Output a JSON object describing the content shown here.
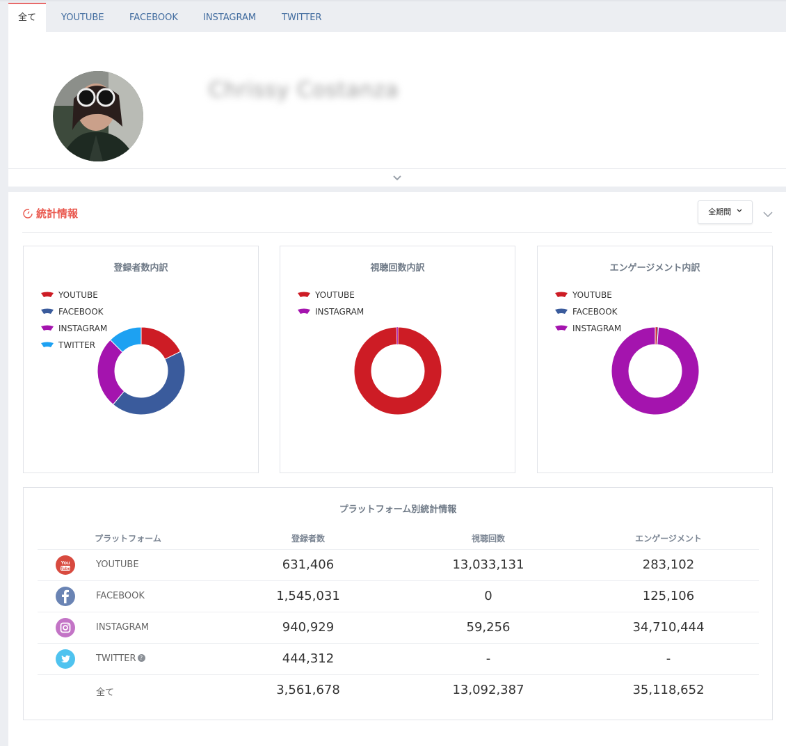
{
  "tabs": [
    "全て",
    "YOUTUBE",
    "FACEBOOK",
    "INSTAGRAM",
    "TWITTER"
  ],
  "profile": {
    "name": "Chrissy Costanza"
  },
  "stats": {
    "title": "統計情報",
    "period_label": "全期間",
    "icons": {
      "section": "gauge-icon",
      "period": "chevron-down-icon",
      "collapse": "chevron-down-icon"
    }
  },
  "colors": {
    "youtube": "#cd1c25",
    "facebook": "#3a5b9c",
    "instagram": "#a414ae",
    "twitter": "#1da1f2",
    "accent": "#e9574d"
  },
  "charts": [
    {
      "title": "登録者数内訳",
      "legend": [
        "YOUTUBE",
        "FACEBOOK",
        "INSTAGRAM",
        "TWITTER"
      ]
    },
    {
      "title": "視聴回数内訳",
      "legend": [
        "YOUTUBE",
        "INSTAGRAM"
      ]
    },
    {
      "title": "エンゲージメント内訳",
      "legend": [
        "YOUTUBE",
        "FACEBOOK",
        "INSTAGRAM"
      ]
    }
  ],
  "chart_data": [
    {
      "type": "pie",
      "title": "登録者数内訳",
      "categories": [
        "YOUTUBE",
        "FACEBOOK",
        "INSTAGRAM",
        "TWITTER"
      ],
      "values": [
        631406,
        1545031,
        940929,
        444312
      ],
      "colors": [
        "#cd1c25",
        "#3a5b9c",
        "#a414ae",
        "#1da1f2"
      ]
    },
    {
      "type": "pie",
      "title": "視聴回数内訳",
      "categories": [
        "YOUTUBE",
        "INSTAGRAM"
      ],
      "values": [
        13033131,
        59256
      ],
      "colors": [
        "#cd1c25",
        "#a414ae"
      ]
    },
    {
      "type": "pie",
      "title": "エンゲージメント内訳",
      "categories": [
        "YOUTUBE",
        "FACEBOOK",
        "INSTAGRAM"
      ],
      "values": [
        283102,
        125106,
        34710444
      ],
      "colors": [
        "#cd1c25",
        "#3a5b9c",
        "#a414ae"
      ]
    }
  ],
  "table": {
    "title": "プラットフォーム別統計情報",
    "headers": [
      "プラットフォーム",
      "登録者数",
      "視聴回数",
      "エンゲージメント"
    ],
    "rows": [
      {
        "platform": "YOUTUBE",
        "icon": "youtube-icon",
        "subscribers": "631,406",
        "views": "13,033,131",
        "engagement": "283,102"
      },
      {
        "platform": "FACEBOOK",
        "icon": "facebook-icon",
        "subscribers": "1,545,031",
        "views": "0",
        "engagement": "125,106"
      },
      {
        "platform": "INSTAGRAM",
        "icon": "instagram-icon",
        "subscribers": "940,929",
        "views": "59,256",
        "engagement": "34,710,444"
      },
      {
        "platform": "TWITTER",
        "icon": "twitter-icon",
        "subscribers": "444,312",
        "views": "-",
        "engagement": "-"
      },
      {
        "platform": "全て",
        "icon": "",
        "subscribers": "3,561,678",
        "views": "13,092,387",
        "engagement": "35,118,652"
      }
    ]
  }
}
